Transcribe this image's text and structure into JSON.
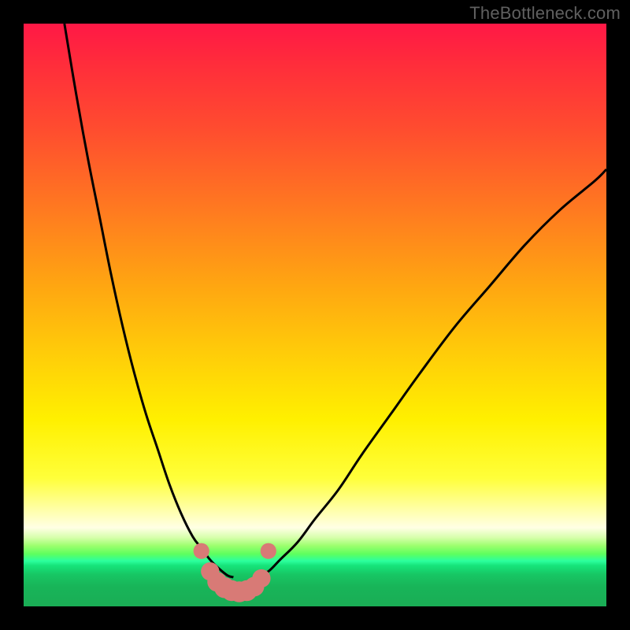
{
  "watermark": "TheBottleneck.com",
  "chart_data": {
    "type": "line",
    "title": "",
    "xlabel": "",
    "ylabel": "",
    "xlim": [
      0,
      100
    ],
    "ylim": [
      0,
      100
    ],
    "series": [
      {
        "name": "left-curve",
        "x": [
          7,
          9,
          11,
          13,
          15,
          17,
          19,
          21,
          23,
          25,
          27,
          29,
          30.5,
          32,
          33.5,
          35,
          36
        ],
        "values": [
          100,
          88,
          77,
          67,
          57,
          48,
          40,
          33,
          27,
          21,
          16,
          12,
          10,
          8,
          6.5,
          5.3,
          5
        ]
      },
      {
        "name": "right-curve",
        "x": [
          40,
          42,
          44,
          47,
          50,
          54,
          58,
          63,
          68,
          74,
          80,
          86,
          92,
          98,
          100
        ],
        "values": [
          5,
          6,
          8,
          11,
          15,
          20,
          26,
          33,
          40,
          48,
          55,
          62,
          68,
          73,
          75
        ]
      }
    ],
    "markers": {
      "name": "bottom-dots",
      "color": "#d87a76",
      "points": [
        {
          "x": 30.5,
          "y": 9.5,
          "r": 1.3
        },
        {
          "x": 32.0,
          "y": 6.0,
          "r": 1.5
        },
        {
          "x": 33.2,
          "y": 4.2,
          "r": 1.6
        },
        {
          "x": 34.5,
          "y": 3.2,
          "r": 1.7
        },
        {
          "x": 35.7,
          "y": 2.7,
          "r": 1.7
        },
        {
          "x": 37.0,
          "y": 2.5,
          "r": 1.7
        },
        {
          "x": 38.3,
          "y": 2.7,
          "r": 1.7
        },
        {
          "x": 39.6,
          "y": 3.4,
          "r": 1.6
        },
        {
          "x": 40.8,
          "y": 4.8,
          "r": 1.5
        },
        {
          "x": 42.0,
          "y": 9.5,
          "r": 1.3
        }
      ]
    },
    "background_gradient": {
      "top": "#ff1846",
      "mid": "#ffe100",
      "band": "#ffffff",
      "bottom": "#1aad55"
    }
  }
}
